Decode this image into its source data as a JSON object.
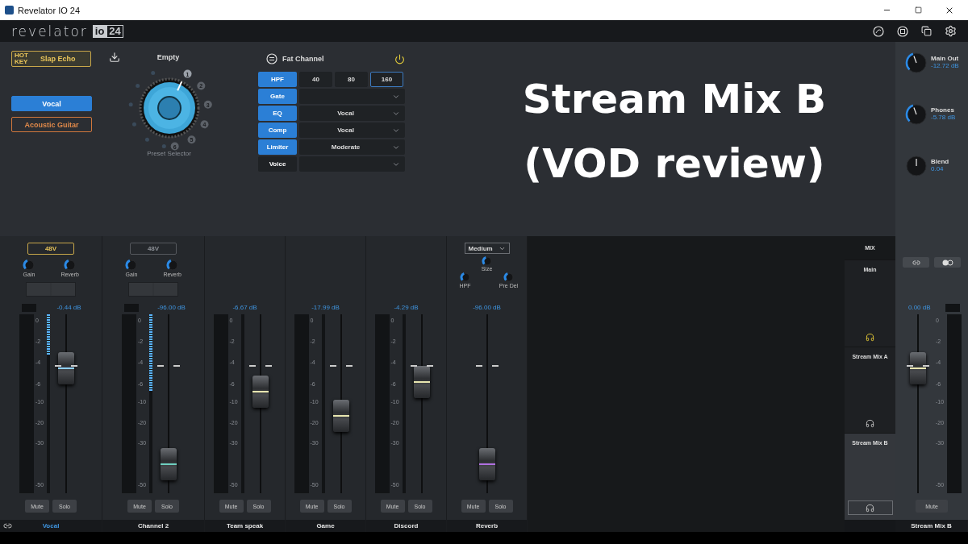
{
  "window": {
    "title": "Revelator IO 24"
  },
  "header": {
    "logo": "revelator",
    "badge": [
      "io",
      "24"
    ]
  },
  "hot_key": {
    "tag": "HOT KEY",
    "preset": "Slap Echo"
  },
  "voice_presets": [
    {
      "label": "Vocal",
      "selected": true
    },
    {
      "label": "Acoustic Guitar",
      "selected": false
    }
  ],
  "preset": {
    "name": "Empty",
    "caption": "Preset Selector",
    "positions": [
      {
        "label": "1",
        "selected": true
      },
      {
        "label": "2",
        "selected": false
      },
      {
        "label": "3",
        "selected": false
      },
      {
        "label": "4",
        "selected": false
      },
      {
        "label": "5",
        "selected": false
      },
      {
        "label": "6",
        "selected": false
      }
    ]
  },
  "fat_channel": {
    "title": "Fat Channel",
    "power": true,
    "hpf": {
      "label": "HPF",
      "on": true,
      "options": [
        {
          "label": "40",
          "selected": false
        },
        {
          "label": "80",
          "selected": false
        },
        {
          "label": "160",
          "selected": true
        }
      ]
    },
    "modules": [
      {
        "label": "Gate",
        "on": true
      },
      {
        "label": "EQ",
        "on": true,
        "value": "Vocal"
      },
      {
        "label": "Comp",
        "on": true,
        "value": "Vocal"
      },
      {
        "label": "Limiter",
        "on": true,
        "value": "Moderate"
      },
      {
        "label": "Voice",
        "on": false
      }
    ]
  },
  "overlay_title": [
    "Stream Mix B",
    "(VOD review)"
  ],
  "outputs": [
    {
      "label": "Main Out",
      "reading": "-12.72 dB",
      "kind": "volume"
    },
    {
      "label": "Phones",
      "reading": "-5.78 dB",
      "kind": "volume"
    },
    {
      "label": "Blend",
      "reading": "0.04",
      "kind": "bipolar"
    }
  ],
  "channels": [
    {
      "name": "Vocal",
      "selected": true,
      "linked": true,
      "phantom": {
        "label": "48V",
        "on": true
      },
      "knobs": [
        {
          "label": "Gain"
        },
        {
          "label": "Reverb"
        }
      ],
      "reading": "-0.44 dB",
      "reduction": {
        "level": 0.23
      },
      "scale": [
        "0",
        "-2",
        "-4",
        "-6",
        "-10",
        "-20",
        "-30",
        "-50"
      ],
      "fader": {
        "level": 0.74,
        "color": "#8fd0ff"
      },
      "mute": "Mute",
      "solo": "Solo"
    },
    {
      "name": "Channel 2",
      "selected": false,
      "phantom": {
        "label": "48V",
        "on": false
      },
      "knobs": [
        {
          "label": "Gain"
        },
        {
          "label": "Reverb"
        }
      ],
      "reading": "-96.00 dB",
      "reduction": {
        "level": 0.43
      },
      "scale": [
        "0",
        "-2",
        "-4",
        "-6",
        "-10",
        "-20",
        "-30",
        "-50"
      ],
      "fader": {
        "level": 0.09,
        "color": "#6fd0c0"
      },
      "mute": "Mute",
      "solo": "Solo"
    },
    {
      "name": "Team speak",
      "selected": false,
      "reading": "-6.67 dB",
      "scale": [
        "0",
        "-2",
        "-4",
        "-6",
        "-10",
        "-20",
        "-30",
        "-50"
      ],
      "fader": {
        "level": 0.58,
        "color": "#e8e6b0"
      },
      "mute": "Mute",
      "solo": "Solo"
    },
    {
      "name": "Game",
      "selected": false,
      "reading": "-17.99 dB",
      "scale": [
        "0",
        "-2",
        "-4",
        "-6",
        "-10",
        "-20",
        "-30",
        "-50"
      ],
      "fader": {
        "level": 0.42,
        "color": "#e8e6b0"
      },
      "mute": "Mute",
      "solo": "Solo"
    },
    {
      "name": "Discord",
      "selected": false,
      "reading": "-4.29 dB",
      "scale": [
        "0",
        "-2",
        "-4",
        "-6",
        "-10",
        "-20",
        "-30",
        "-50"
      ],
      "fader": {
        "level": 0.65,
        "color": "#e8e6b0"
      },
      "mute": "Mute",
      "solo": "Solo"
    },
    {
      "name": "Reverb",
      "selected": false,
      "preset_select": "Medium",
      "knobs": [
        {
          "label": "Size"
        },
        {
          "label": "HPF"
        },
        {
          "label": "Pre Del"
        }
      ],
      "reading": "-96.00 dB",
      "fader": {
        "level": 0.09,
        "color": "#b070e0"
      },
      "mute": "Mute",
      "solo": "Solo"
    }
  ],
  "mix": {
    "title": "MIX",
    "items": [
      {
        "label": "Main",
        "selected": false,
        "monitor": true
      },
      {
        "label": "Stream Mix A",
        "selected": false,
        "monitor": false
      },
      {
        "label": "Stream Mix B",
        "selected": true,
        "monitor": false
      }
    ]
  },
  "master": {
    "name": "Stream Mix B",
    "reading": "0.00 dB",
    "scale": [
      "0",
      "-2",
      "-4",
      "-6",
      "-10",
      "-20",
      "-30",
      "-50"
    ],
    "fader": {
      "level": 0.74,
      "color": "#e8e6b0"
    },
    "mute": "Mute"
  }
}
